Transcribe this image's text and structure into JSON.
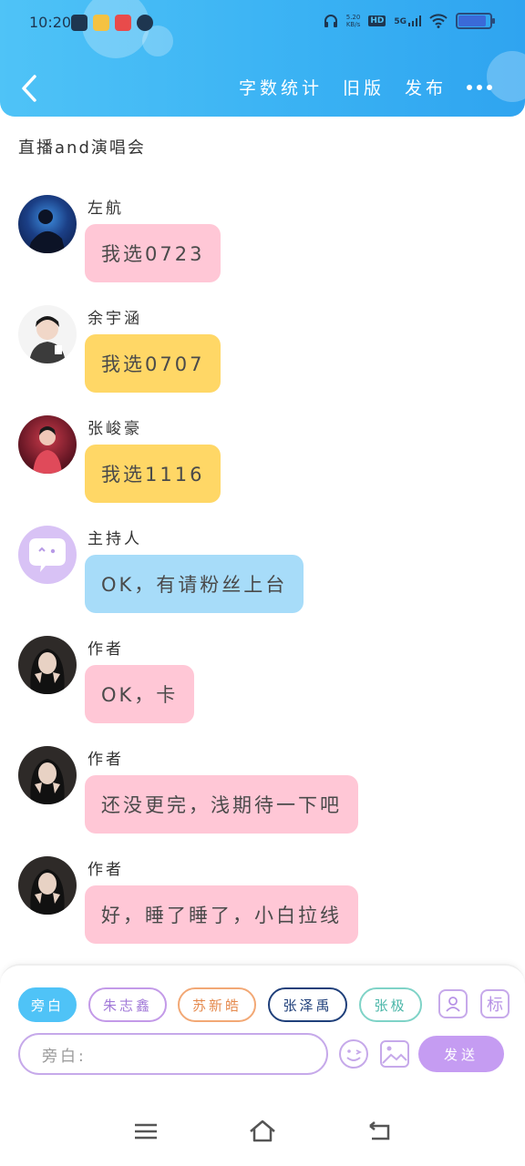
{
  "status_bar": {
    "time": "10:20",
    "net_speed_value": "5.20",
    "net_speed_unit": "KB/s",
    "hd": "HD",
    "network": "5G"
  },
  "header": {
    "actions": [
      "字数统计",
      "旧版",
      "发布"
    ]
  },
  "doc_title": "直播and演唱会",
  "messages": [
    {
      "speaker": "左航",
      "text": "我选0723",
      "color": "pink"
    },
    {
      "speaker": "余宇涵",
      "text": "我选0707",
      "color": "yellow"
    },
    {
      "speaker": "张峻豪",
      "text": "我选1116",
      "color": "yellow"
    },
    {
      "speaker": "主持人",
      "text": "OK，有请粉丝上台",
      "color": "blue"
    },
    {
      "speaker": "作者",
      "text": "OK，卡",
      "color": "pink"
    },
    {
      "speaker": "作者",
      "text": "还没更完，浅期待一下吧",
      "color": "pink"
    },
    {
      "speaker": "作者",
      "text": "好，睡了睡了，小白拉线",
      "color": "pink"
    }
  ],
  "bottom": {
    "chips": [
      "旁白",
      "朱志鑫",
      "苏新皓",
      "张泽禹",
      "张极"
    ],
    "tag_icon_label": "标",
    "input_placeholder": "旁白:",
    "send_label": "发送"
  },
  "colors": {
    "header": "#39b1f3",
    "bubble_pink": "#ffc7d6",
    "bubble_yellow": "#ffd766",
    "bubble_blue": "#a7dcf9",
    "accent_purple": "#c59cf2"
  }
}
